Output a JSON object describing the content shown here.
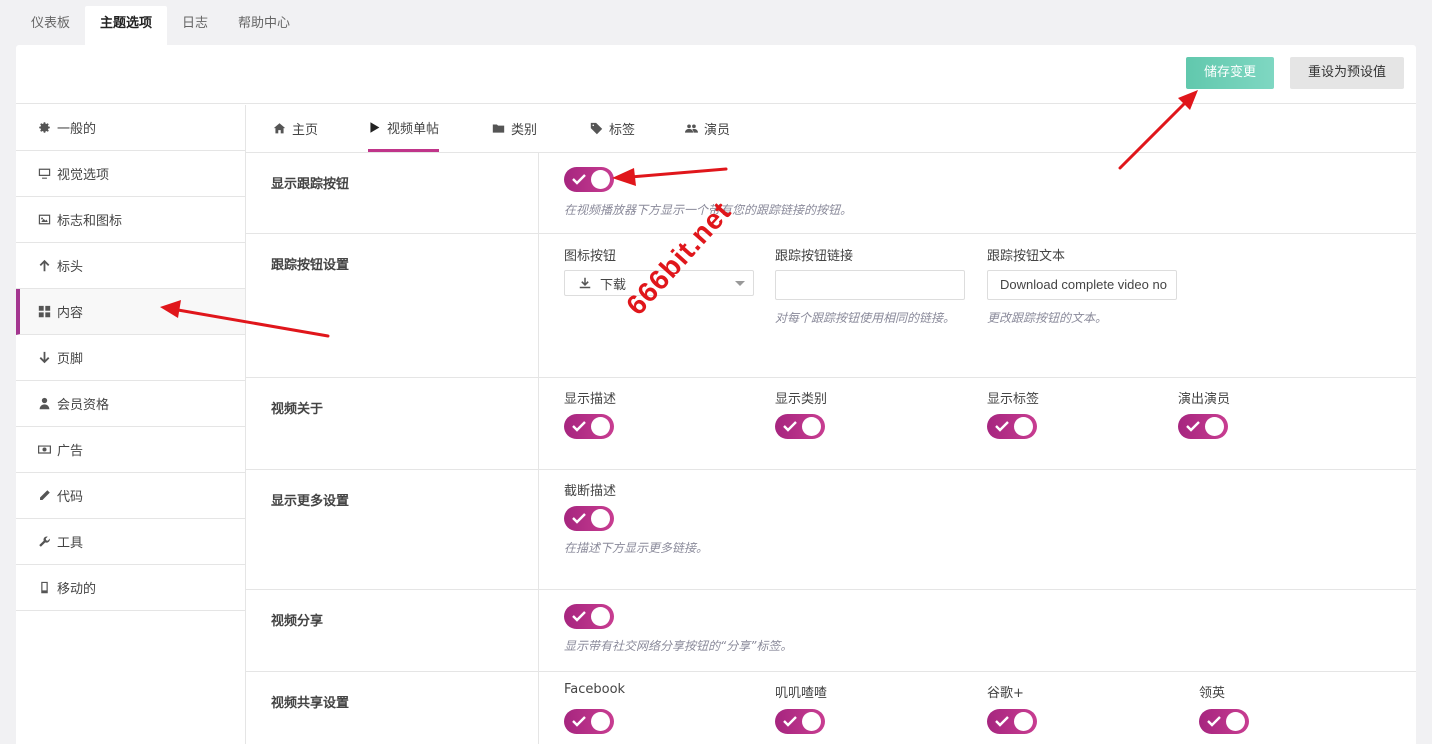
{
  "top_tabs": [
    {
      "label": "仪表板"
    },
    {
      "label": "主题选项",
      "active": true
    },
    {
      "label": "日志"
    },
    {
      "label": "帮助中心"
    }
  ],
  "header": {
    "save_label": "储存变更",
    "reset_label": "重设为预设值"
  },
  "sidebar": {
    "items": [
      {
        "label": "一般的",
        "icon": "gear-icon"
      },
      {
        "label": "视觉选项",
        "icon": "monitor-icon"
      },
      {
        "label": "标志和图标",
        "icon": "image-icon"
      },
      {
        "label": "标头",
        "icon": "arrow-up-icon"
      },
      {
        "label": "内容",
        "icon": "grid-icon",
        "active": true
      },
      {
        "label": "页脚",
        "icon": "arrow-down-icon"
      },
      {
        "label": "会员资格",
        "icon": "user-icon"
      },
      {
        "label": "广告",
        "icon": "money-icon"
      },
      {
        "label": "代码",
        "icon": "pencil-icon"
      },
      {
        "label": "工具",
        "icon": "wrench-icon"
      },
      {
        "label": "移动的",
        "icon": "mobile-icon"
      }
    ]
  },
  "sub_tabs": [
    {
      "label": "主页",
      "icon": "home-icon"
    },
    {
      "label": "视频单帖",
      "icon": "play-icon",
      "active": true
    },
    {
      "label": "类别",
      "icon": "folder-icon"
    },
    {
      "label": "标签",
      "icon": "tag-icon"
    },
    {
      "label": "演员",
      "icon": "users-icon"
    }
  ],
  "rows": {
    "tracking_button": {
      "label": "显示跟踪按钮",
      "enabled": true,
      "desc": "在视频播放器下方显示一个带有您的跟踪链接的按钮。"
    },
    "tracking_settings": {
      "label": "跟踪按钮设置",
      "icon_label": "图标按钮",
      "icon_value": "下载",
      "link_label": "跟踪按钮链接",
      "link_value": "",
      "link_desc": "对每个跟踪按钮使用相同的链接。",
      "text_label": "跟踪按钮文本",
      "text_value": "Download complete video no",
      "text_desc": "更改跟踪按钮的文本。"
    },
    "video_about": {
      "label": "视频关于",
      "options": [
        {
          "label": "显示描述",
          "enabled": true
        },
        {
          "label": "显示类别",
          "enabled": true
        },
        {
          "label": "显示标签",
          "enabled": true
        },
        {
          "label": "演出演员",
          "enabled": true
        }
      ]
    },
    "show_more": {
      "label": "显示更多设置",
      "field_label": "截断描述",
      "enabled": true,
      "desc": "在描述下方显示更多链接。"
    },
    "video_share": {
      "label": "视频分享",
      "enabled": true,
      "desc": "显示带有社交网络分享按钮的“分享”标签。"
    },
    "share_settings": {
      "label": "视频共享设置",
      "options": [
        {
          "label": "Facebook",
          "enabled": true
        },
        {
          "label": "叽叽喳喳",
          "enabled": true
        },
        {
          "label": "谷歌+",
          "enabled": true
        },
        {
          "label": "领英",
          "enabled": true
        }
      ]
    }
  },
  "watermark": "666bit.net",
  "colors": {
    "accent": "#c0358a",
    "save": "#61c8ad",
    "arrow": "#e0161b"
  }
}
